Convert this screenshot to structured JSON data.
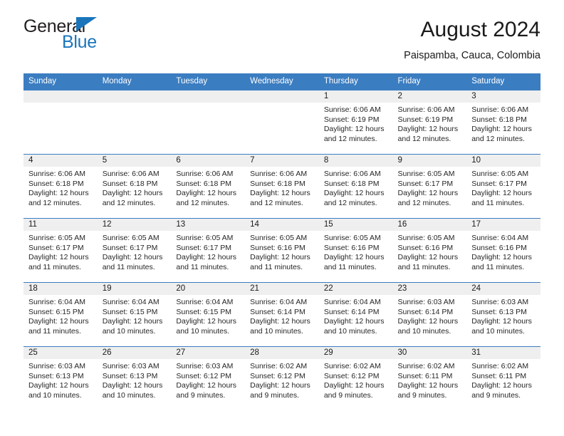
{
  "brand": {
    "name_part1": "General",
    "name_part2": "Blue",
    "colors": {
      "dark": "#231f20",
      "blue": "#1b75bb"
    }
  },
  "header": {
    "title": "August 2024",
    "subtitle": "Paispamba, Cauca, Colombia"
  },
  "theme": {
    "header_blue": "#3b7dc1",
    "daynum_band": "#efefef",
    "text": "#262626"
  },
  "weekdays": [
    "Sunday",
    "Monday",
    "Tuesday",
    "Wednesday",
    "Thursday",
    "Friday",
    "Saturday"
  ],
  "weeks": [
    [
      {
        "day": "",
        "sunrise": "",
        "sunset": "",
        "daylight1": "",
        "daylight2": ""
      },
      {
        "day": "",
        "sunrise": "",
        "sunset": "",
        "daylight1": "",
        "daylight2": ""
      },
      {
        "day": "",
        "sunrise": "",
        "sunset": "",
        "daylight1": "",
        "daylight2": ""
      },
      {
        "day": "",
        "sunrise": "",
        "sunset": "",
        "daylight1": "",
        "daylight2": ""
      },
      {
        "day": "1",
        "sunrise": "Sunrise: 6:06 AM",
        "sunset": "Sunset: 6:19 PM",
        "daylight1": "Daylight: 12 hours",
        "daylight2": "and 12 minutes."
      },
      {
        "day": "2",
        "sunrise": "Sunrise: 6:06 AM",
        "sunset": "Sunset: 6:19 PM",
        "daylight1": "Daylight: 12 hours",
        "daylight2": "and 12 minutes."
      },
      {
        "day": "3",
        "sunrise": "Sunrise: 6:06 AM",
        "sunset": "Sunset: 6:18 PM",
        "daylight1": "Daylight: 12 hours",
        "daylight2": "and 12 minutes."
      }
    ],
    [
      {
        "day": "4",
        "sunrise": "Sunrise: 6:06 AM",
        "sunset": "Sunset: 6:18 PM",
        "daylight1": "Daylight: 12 hours",
        "daylight2": "and 12 minutes."
      },
      {
        "day": "5",
        "sunrise": "Sunrise: 6:06 AM",
        "sunset": "Sunset: 6:18 PM",
        "daylight1": "Daylight: 12 hours",
        "daylight2": "and 12 minutes."
      },
      {
        "day": "6",
        "sunrise": "Sunrise: 6:06 AM",
        "sunset": "Sunset: 6:18 PM",
        "daylight1": "Daylight: 12 hours",
        "daylight2": "and 12 minutes."
      },
      {
        "day": "7",
        "sunrise": "Sunrise: 6:06 AM",
        "sunset": "Sunset: 6:18 PM",
        "daylight1": "Daylight: 12 hours",
        "daylight2": "and 12 minutes."
      },
      {
        "day": "8",
        "sunrise": "Sunrise: 6:06 AM",
        "sunset": "Sunset: 6:18 PM",
        "daylight1": "Daylight: 12 hours",
        "daylight2": "and 12 minutes."
      },
      {
        "day": "9",
        "sunrise": "Sunrise: 6:05 AM",
        "sunset": "Sunset: 6:17 PM",
        "daylight1": "Daylight: 12 hours",
        "daylight2": "and 12 minutes."
      },
      {
        "day": "10",
        "sunrise": "Sunrise: 6:05 AM",
        "sunset": "Sunset: 6:17 PM",
        "daylight1": "Daylight: 12 hours",
        "daylight2": "and 11 minutes."
      }
    ],
    [
      {
        "day": "11",
        "sunrise": "Sunrise: 6:05 AM",
        "sunset": "Sunset: 6:17 PM",
        "daylight1": "Daylight: 12 hours",
        "daylight2": "and 11 minutes."
      },
      {
        "day": "12",
        "sunrise": "Sunrise: 6:05 AM",
        "sunset": "Sunset: 6:17 PM",
        "daylight1": "Daylight: 12 hours",
        "daylight2": "and 11 minutes."
      },
      {
        "day": "13",
        "sunrise": "Sunrise: 6:05 AM",
        "sunset": "Sunset: 6:17 PM",
        "daylight1": "Daylight: 12 hours",
        "daylight2": "and 11 minutes."
      },
      {
        "day": "14",
        "sunrise": "Sunrise: 6:05 AM",
        "sunset": "Sunset: 6:16 PM",
        "daylight1": "Daylight: 12 hours",
        "daylight2": "and 11 minutes."
      },
      {
        "day": "15",
        "sunrise": "Sunrise: 6:05 AM",
        "sunset": "Sunset: 6:16 PM",
        "daylight1": "Daylight: 12 hours",
        "daylight2": "and 11 minutes."
      },
      {
        "day": "16",
        "sunrise": "Sunrise: 6:05 AM",
        "sunset": "Sunset: 6:16 PM",
        "daylight1": "Daylight: 12 hours",
        "daylight2": "and 11 minutes."
      },
      {
        "day": "17",
        "sunrise": "Sunrise: 6:04 AM",
        "sunset": "Sunset: 6:16 PM",
        "daylight1": "Daylight: 12 hours",
        "daylight2": "and 11 minutes."
      }
    ],
    [
      {
        "day": "18",
        "sunrise": "Sunrise: 6:04 AM",
        "sunset": "Sunset: 6:15 PM",
        "daylight1": "Daylight: 12 hours",
        "daylight2": "and 11 minutes."
      },
      {
        "day": "19",
        "sunrise": "Sunrise: 6:04 AM",
        "sunset": "Sunset: 6:15 PM",
        "daylight1": "Daylight: 12 hours",
        "daylight2": "and 10 minutes."
      },
      {
        "day": "20",
        "sunrise": "Sunrise: 6:04 AM",
        "sunset": "Sunset: 6:15 PM",
        "daylight1": "Daylight: 12 hours",
        "daylight2": "and 10 minutes."
      },
      {
        "day": "21",
        "sunrise": "Sunrise: 6:04 AM",
        "sunset": "Sunset: 6:14 PM",
        "daylight1": "Daylight: 12 hours",
        "daylight2": "and 10 minutes."
      },
      {
        "day": "22",
        "sunrise": "Sunrise: 6:04 AM",
        "sunset": "Sunset: 6:14 PM",
        "daylight1": "Daylight: 12 hours",
        "daylight2": "and 10 minutes."
      },
      {
        "day": "23",
        "sunrise": "Sunrise: 6:03 AM",
        "sunset": "Sunset: 6:14 PM",
        "daylight1": "Daylight: 12 hours",
        "daylight2": "and 10 minutes."
      },
      {
        "day": "24",
        "sunrise": "Sunrise: 6:03 AM",
        "sunset": "Sunset: 6:13 PM",
        "daylight1": "Daylight: 12 hours",
        "daylight2": "and 10 minutes."
      }
    ],
    [
      {
        "day": "25",
        "sunrise": "Sunrise: 6:03 AM",
        "sunset": "Sunset: 6:13 PM",
        "daylight1": "Daylight: 12 hours",
        "daylight2": "and 10 minutes."
      },
      {
        "day": "26",
        "sunrise": "Sunrise: 6:03 AM",
        "sunset": "Sunset: 6:13 PM",
        "daylight1": "Daylight: 12 hours",
        "daylight2": "and 10 minutes."
      },
      {
        "day": "27",
        "sunrise": "Sunrise: 6:03 AM",
        "sunset": "Sunset: 6:12 PM",
        "daylight1": "Daylight: 12 hours",
        "daylight2": "and 9 minutes."
      },
      {
        "day": "28",
        "sunrise": "Sunrise: 6:02 AM",
        "sunset": "Sunset: 6:12 PM",
        "daylight1": "Daylight: 12 hours",
        "daylight2": "and 9 minutes."
      },
      {
        "day": "29",
        "sunrise": "Sunrise: 6:02 AM",
        "sunset": "Sunset: 6:12 PM",
        "daylight1": "Daylight: 12 hours",
        "daylight2": "and 9 minutes."
      },
      {
        "day": "30",
        "sunrise": "Sunrise: 6:02 AM",
        "sunset": "Sunset: 6:11 PM",
        "daylight1": "Daylight: 12 hours",
        "daylight2": "and 9 minutes."
      },
      {
        "day": "31",
        "sunrise": "Sunrise: 6:02 AM",
        "sunset": "Sunset: 6:11 PM",
        "daylight1": "Daylight: 12 hours",
        "daylight2": "and 9 minutes."
      }
    ]
  ]
}
